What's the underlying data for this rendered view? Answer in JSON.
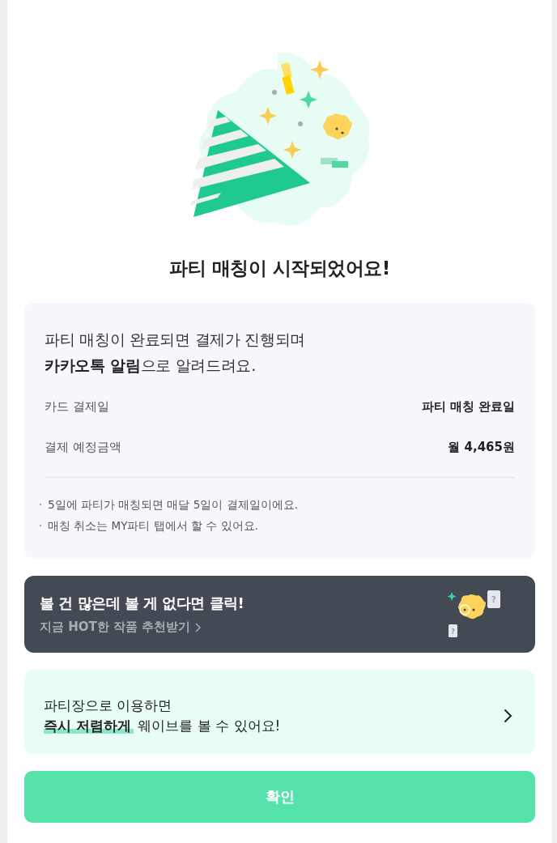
{
  "title": "파티 매칭이 시작되었어요!",
  "notice": {
    "message": "파티 매칭이 완료되면 결제가 진행되며\n**카카오톡 알림**으로 알려드려요.",
    "rows": [
      {
        "label": "카드 결제일",
        "value": "파티 매칭 완료일"
      },
      {
        "label": "결제 예정금액",
        "value": "월 4,465원"
      }
    ],
    "notes": [
      "5일에 파티가 매칭되면 매달 5일이 결제일이에요.",
      "매칭 취소는 MY파티 탭에서 할 수 있어요."
    ]
  },
  "banner": {
    "title": "볼 건 많은데 볼 게 없다면 클릭!",
    "link": "지금 HOT한 작품 추천받기",
    "card_marks": [
      "?",
      "?"
    ]
  },
  "leader_card": {
    "message": "파티장으로 이용하면\n**즉시 저렴하게** 웨이브를 볼 수 있어요!"
  },
  "confirm_button": {
    "label": "확인"
  }
}
